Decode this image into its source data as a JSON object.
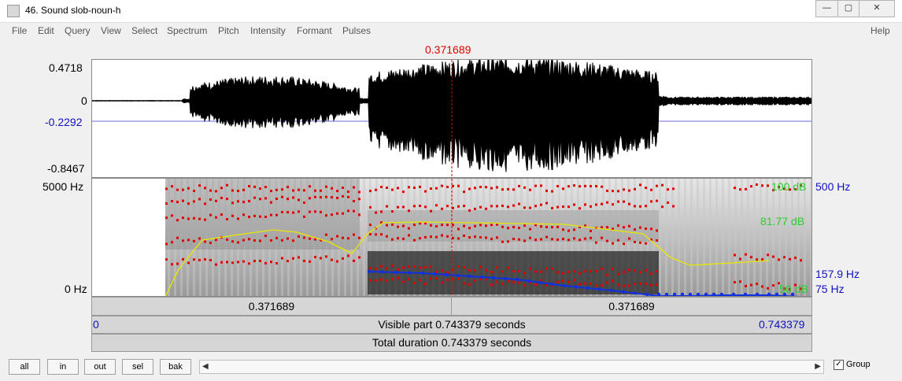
{
  "window": {
    "title": "46. Sound slob-noun-h",
    "controls": {
      "minimize": "—",
      "restore": "▢",
      "close": "✕"
    }
  },
  "menu": {
    "items": [
      "File",
      "Edit",
      "Query",
      "View",
      "Select",
      "Spectrum",
      "Pitch",
      "Intensity",
      "Formant",
      "Pulses"
    ],
    "help": "Help"
  },
  "waveform": {
    "cursor_time": "0.371689",
    "ymax": "0.4718",
    "zero": "0",
    "blue_level": "-0.2292",
    "ymin": "-0.8467"
  },
  "spectrogram": {
    "freq_top": "5000 Hz",
    "freq_bottom": "0 Hz",
    "intensity_top": "100 dB",
    "pitch_top": "500 Hz",
    "intensity_current": "81.77 dB",
    "pitch_current": "157.9 Hz",
    "intensity_bottom": "50 dB",
    "pitch_bottom": "75 Hz"
  },
  "time_segments": {
    "left": "0.371689",
    "right": "0.371689",
    "visible_start": "0",
    "visible_label": "Visible part 0.743379 seconds",
    "visible_end": "0.743379",
    "total_label": "Total duration 0.743379 seconds"
  },
  "buttons": {
    "all": "all",
    "in": "in",
    "out": "out",
    "sel": "sel",
    "bak": "bak"
  },
  "group": {
    "label": "Group",
    "checked": true
  },
  "colors": {
    "cursor": "#d00000",
    "pitch": "#1030e0",
    "intensity": "#e8e800",
    "formant": "#e00000"
  }
}
